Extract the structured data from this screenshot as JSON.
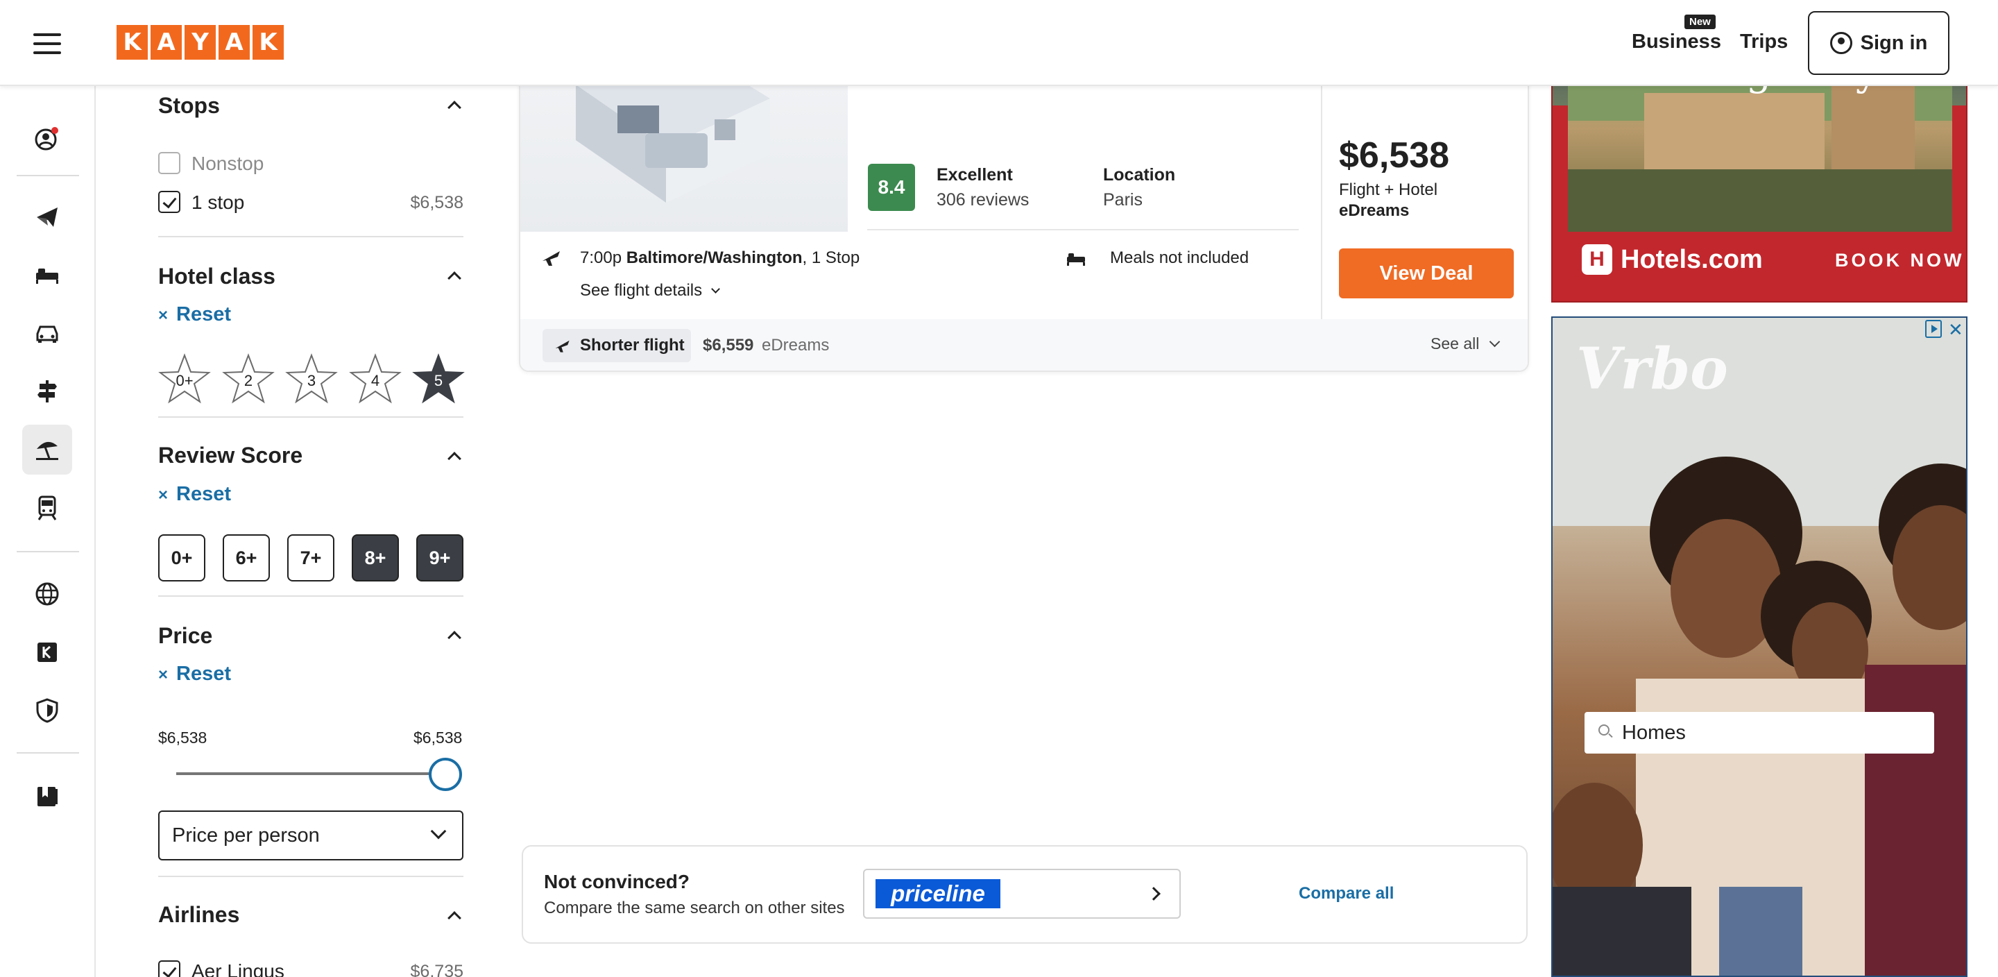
{
  "header": {
    "logo_letters": [
      "K",
      "A",
      "Y",
      "A",
      "K"
    ],
    "links": {
      "business": "Business",
      "new_badge": "New",
      "trips": "Trips",
      "sign_in": "Sign in"
    }
  },
  "rail": {
    "icons": [
      "user-alert-icon",
      "plane-icon",
      "bed-icon",
      "car-icon",
      "signpost-icon",
      "beach-icon",
      "train-icon",
      "globe-icon",
      "kayak-k-icon",
      "shield-icon",
      "bookmark-icon"
    ],
    "active": "beach-icon"
  },
  "filters": {
    "stops": {
      "title": "Stops",
      "options": [
        {
          "label": "Nonstop",
          "checked": false,
          "price": ""
        },
        {
          "label": "1 stop",
          "checked": true,
          "price": "$6,538"
        }
      ]
    },
    "hotel_class": {
      "title": "Hotel class",
      "reset": "Reset",
      "stars": [
        {
          "label": "0+",
          "selected": false
        },
        {
          "label": "2",
          "selected": false
        },
        {
          "label": "3",
          "selected": false
        },
        {
          "label": "4",
          "selected": false
        },
        {
          "label": "5",
          "selected": true
        }
      ]
    },
    "review_score": {
      "title": "Review Score",
      "reset": "Reset",
      "options": [
        {
          "label": "0+",
          "selected": false
        },
        {
          "label": "6+",
          "selected": false
        },
        {
          "label": "7+",
          "selected": false
        },
        {
          "label": "8+",
          "selected": true
        },
        {
          "label": "9+",
          "selected": true
        }
      ]
    },
    "price": {
      "title": "Price",
      "reset": "Reset",
      "min_label": "$6,538",
      "max_label": "$6,538",
      "slider_position": 1.0,
      "select_value": "Price per person"
    },
    "airlines": {
      "title": "Airlines",
      "options": [
        {
          "label": "Aer Lingus",
          "checked": true,
          "price": "$6,735"
        }
      ]
    }
  },
  "result": {
    "stars": "★★★★★",
    "score": "8.4",
    "rating_label": "Excellent",
    "reviews": "306 reviews",
    "location_label": "Location",
    "location": "Paris",
    "price": "$6,538",
    "package": "Flight + Hotel",
    "provider": "eDreams",
    "deal_button": "View Deal",
    "flight_time": "7:00p",
    "flight_origin": "Baltimore/Washington",
    "flight_stops": ", 1 Stop",
    "flight_details": "See flight details",
    "meals": "Meals not included",
    "footer": {
      "chip": "Shorter flight",
      "alt_price": "$6,559",
      "alt_provider": "eDreams",
      "see_all": "See all"
    }
  },
  "compare": {
    "title": "Not convinced?",
    "subtitle": "Compare the same search on other sites",
    "partner": "priceline",
    "compare_all": "Compare all"
  },
  "ads": {
    "hotels": {
      "tagline": "is waiting for you",
      "brand": "Hotels.com",
      "cta": "BOOK NOW"
    },
    "vrbo": {
      "brand": "Vrbo",
      "search_value": "Homes"
    }
  },
  "colors": {
    "kayak_orange": "#f2691e",
    "link_blue": "#1a6ea5",
    "score_green": "#3c8a4f",
    "deal_orange": "#f06b24"
  }
}
